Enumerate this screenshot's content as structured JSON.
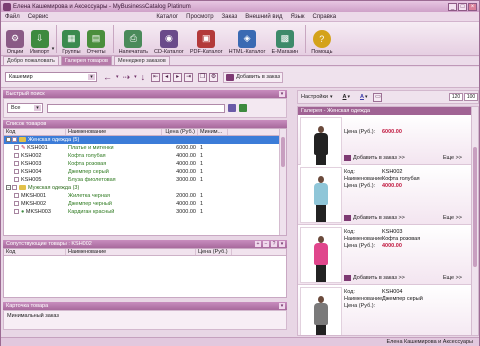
{
  "window": {
    "title": "Елена Кашемирова и Аксессуары - MyBusinessCatalog Platinum"
  },
  "menu": [
    "Файл",
    "Сервис",
    "Каталог",
    "Просмотр",
    "Заказ",
    "Внешний вид",
    "Язык",
    "Справка"
  ],
  "toolbar": [
    {
      "label": "Опции",
      "color": "#8a5a86",
      "icon": "gear-icon"
    },
    {
      "label": "Импорт",
      "color": "#3d8a3f",
      "icon": "import-icon"
    },
    {
      "label": "Группы",
      "color": "#3b8a4f",
      "icon": "groups-icon"
    },
    {
      "label": "Отчеты",
      "color": "#4a8e3c",
      "icon": "reports-icon"
    },
    {
      "label": "Напечатать",
      "color": "#4a8a5a",
      "icon": "print-icon"
    },
    {
      "label": "CD-Каталог",
      "color": "#6a4a8a",
      "icon": "cd-icon"
    },
    {
      "label": "PDF-Каталог",
      "color": "#b33a3a",
      "icon": "pdf-icon"
    },
    {
      "label": "HTML-Каталог",
      "color": "#3a6ab3",
      "icon": "html-icon"
    },
    {
      "label": "E-Магазин",
      "color": "#3d8a6a",
      "icon": "shop-icon"
    },
    {
      "label": "Помощь",
      "color": "#d4a21a",
      "icon": "help-icon"
    }
  ],
  "tabs": [
    "Добро пожаловать",
    "Галерея товаров",
    "Менеджер заказов"
  ],
  "subtoolbar": {
    "catalog_select": "Кашемир",
    "add_to_cart": "Добавить в заказ"
  },
  "quick_search": {
    "title": "Быстрый поиск",
    "filter": "Все"
  },
  "product_list": {
    "title": "Список товаров",
    "columns": [
      "Код",
      "Наименование",
      "Цена (Руб.)",
      "Миним..."
    ],
    "group1": "Женская одежда  (5)",
    "rows1": [
      {
        "code": "KSH001",
        "name": "Платье и митенки",
        "price": "6000.00",
        "min": "1"
      },
      {
        "code": "KSH002",
        "name": "Кофта голубая",
        "price": "4000.00",
        "min": "1"
      },
      {
        "code": "KSH003",
        "name": "Кофта розовая",
        "price": "4000.00",
        "min": "1"
      },
      {
        "code": "KSH004",
        "name": "Джемпер серый",
        "price": "4000.00",
        "min": "1"
      },
      {
        "code": "KSH005",
        "name": "Блуза фиолетовая",
        "price": "3000.00",
        "min": "1"
      }
    ],
    "group2": "Мужская одежда  (3)",
    "rows2": [
      {
        "code": "MKSH001",
        "name": "Жилетка черная",
        "price": "2000.00",
        "min": "1"
      },
      {
        "code": "MKSH002",
        "name": "Джемпер черный",
        "price": "4000.00",
        "min": "1"
      },
      {
        "code": "MKSH003",
        "name": "Кардиган красный",
        "price": "3000.00",
        "min": "1"
      }
    ]
  },
  "related": {
    "title": "Сопутствующие товары : KSH002",
    "columns": [
      "Код",
      "Наименование",
      "Цена (Руб.)"
    ]
  },
  "card": {
    "title": "Карточка товара",
    "field": "Минимальный заказ"
  },
  "right": {
    "settings": "Настройки",
    "zoom1": "120",
    "zoom2": "100"
  },
  "gallery": {
    "caption": "Галерея - Женская одежда",
    "k_code": "Код:",
    "k_name": "Наименование:",
    "k_price": "Цена (Руб.):",
    "add": "Добавить в заказ >>",
    "more": "Еще >>",
    "items": [
      {
        "code": "",
        "name": "",
        "price": "6000.00",
        "color": "#222222"
      },
      {
        "code": "KSH002",
        "name": "Кофта голубая",
        "price": "4000.00",
        "color": "#8fc6d8"
      },
      {
        "code": "KSH003",
        "name": "Кофта розовая",
        "price": "4000.00",
        "color": "#e0468c"
      },
      {
        "code": "KSH004",
        "name": "Джемпер серый",
        "price": "",
        "color": "#7a7a7a"
      }
    ]
  },
  "status": "Елена Кашемирова и Аксессуары"
}
